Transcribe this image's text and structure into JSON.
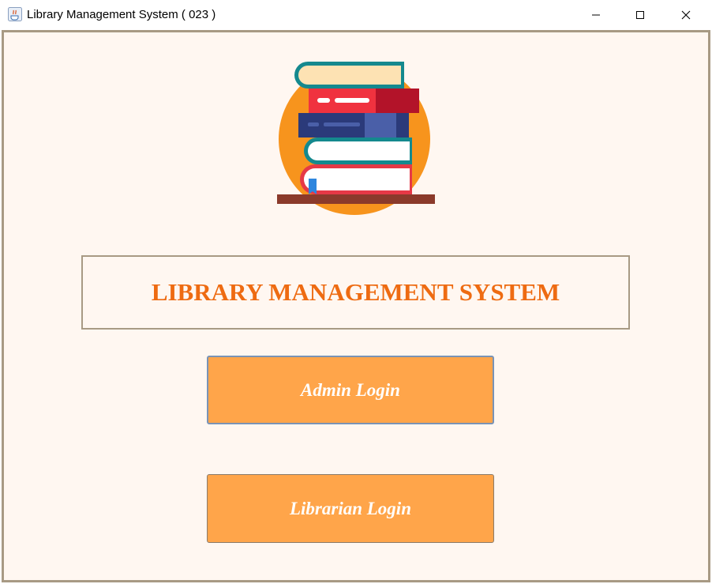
{
  "window": {
    "title": "Library Management System ( 023 )",
    "icon": "java-coffee-icon",
    "controls": [
      "minimize-icon",
      "maximize-icon",
      "close-icon"
    ]
  },
  "main": {
    "logo": "books-stack-icon",
    "heading": "LIBRARY MANAGEMENT SYSTEM",
    "buttons": {
      "admin_login": "Admin Login",
      "librarian_login": "Librarian Login"
    }
  },
  "colors": {
    "background": "#fff7f1",
    "border": "#a89a84",
    "heading": "#ee6b12",
    "button": "#ffa54a",
    "button_text": "#ffffff"
  }
}
